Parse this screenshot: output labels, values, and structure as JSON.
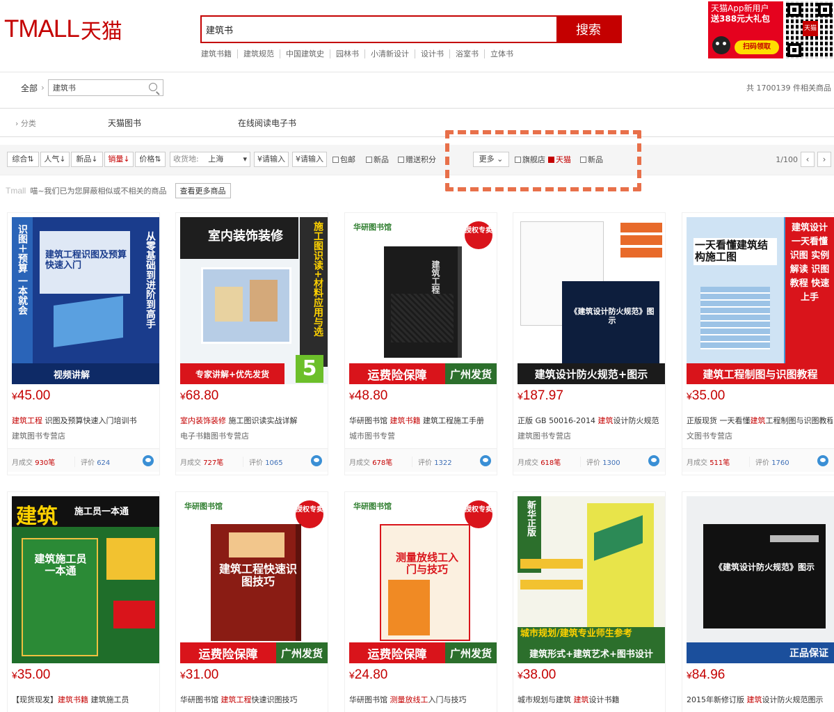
{
  "header": {
    "logo_en": "TMALL",
    "logo_zh": "天猫",
    "search_value": "建筑书",
    "search_button": "搜索",
    "hot_words": [
      "建筑书籍",
      "建筑规范",
      "中国建筑史",
      "园林书",
      "小清新设计",
      "设计书",
      "浴室书",
      "立体书"
    ],
    "promo_line1": "天猫App新用户",
    "promo_line2": "送388元大礼包",
    "promo_pill": "扫码领取",
    "qr_badge": "天猫"
  },
  "breadcrumb": {
    "all": "全部",
    "query": "建筑书",
    "total": "共 1700139 件相关商品"
  },
  "category_row": {
    "label": "分类",
    "items": [
      "天猫图书",
      "在线阅读电子书"
    ]
  },
  "filters": {
    "sort": [
      "综合",
      "人气",
      "新品",
      "销量",
      "价格"
    ],
    "ship_label": "收货地:",
    "ship_value": "上海",
    "price_from": "¥请输入",
    "price_to": "¥请输入",
    "checks": [
      "包邮",
      "新品",
      "赠送积分"
    ],
    "more": "更多",
    "tags": [
      "旗舰店",
      "天猫",
      "新品"
    ],
    "pager": "1/100"
  },
  "notice": {
    "logo": "Tmall",
    "text": "喵~我们已为您屏蔽相似或不相关的商品",
    "more_button": "查看更多商品"
  },
  "products": [
    {
      "price": "45.00",
      "kw": "建筑工程",
      "rest": " 识图及预算快速入门培训书",
      "shop": "建筑图书专营店",
      "sales": "930笔",
      "reviews": "624",
      "cover_title": "建筑工程识图及预算快速入门",
      "side_text": "识图＋预算 一本就会",
      "band": "视频讲解"
    },
    {
      "price": "68.80",
      "kw": "室内装饰装修",
      "rest": " 施工图识读实战详解",
      "shop": "电子书籍图书专营店",
      "sales": "727笔",
      "reviews": "1065",
      "cover_title": "室内装饰装修",
      "side_text": "施工图识读+材料应用与选",
      "band": "专家讲解+优先发货",
      "badge": "5"
    },
    {
      "price": "48.80",
      "kw": "建筑书籍",
      "rest": " 建筑工程施工手册",
      "shop": "城市图书专营",
      "sales": "678笔",
      "reviews": "1322",
      "cover_title": "建筑工程施工手册",
      "band_a": "运费险保障",
      "band_b": "广州发货",
      "publisher": "华研图书馆",
      "seal": "授权专卖"
    },
    {
      "price": "187.97",
      "kw": "建筑",
      "rest": "设计防火规范",
      "shop": "建筑图书专营店",
      "sales": "618笔",
      "reviews": "1300",
      "prefix": "正版 GB 50016-2014 ",
      "cover_title": "《建筑设计防火规范》图示",
      "band": "建筑设计防火规范+图示"
    },
    {
      "price": "35.00",
      "kw": "建筑",
      "rest": "工程制图与识图教程",
      "shop": "文图书专营店",
      "sales": "511笔",
      "reviews": "1760",
      "prefix": "正版现货 一天看懂",
      "cover_title": "一天看懂建筑结构施工图",
      "side_text": "建筑设计 一天看懂 识图 实例解读 识图教程 快速上手",
      "band": "建筑工程制图与识图教程"
    },
    {
      "price": "35.00",
      "kw": "建筑书籍",
      "rest": " 建筑施工员",
      "prefix": "【现货现发】",
      "cover_title": "建筑施工员一本通",
      "band": "施工员一本通"
    },
    {
      "price": "31.00",
      "kw": "建筑工程",
      "rest": "快速识图技巧",
      "prefix": "华研图书馆 ",
      "cover_title": "建筑工程快速识图技巧",
      "band_a": "运费险保障",
      "band_b": "广州发货",
      "publisher": "华研图书馆",
      "seal": "授权专卖"
    },
    {
      "price": "24.80",
      "kw": "测量放线工",
      "rest": "入门与技巧",
      "prefix": "华研图书馆 ",
      "cover_title": "测量放线工入门与技巧",
      "band_a": "运费险保障",
      "band_b": "广州发货",
      "publisher": "华研图书馆",
      "seal": "授权专卖"
    },
    {
      "price": "38.00",
      "kw": "建筑",
      "rest": "设计书籍",
      "prefix": "城市规划与建筑 ",
      "cover_title": "城市规划/建筑专业师生参考",
      "side_text": "新华正版",
      "band": "建筑形式+建筑艺术+图书设计"
    },
    {
      "price": "84.96",
      "kw": "建筑",
      "rest": "设计防火规范图示",
      "prefix": "2015年新修订版 ",
      "cover_title": "《建筑设计防火规范》图示",
      "band": "正品保证"
    }
  ]
}
